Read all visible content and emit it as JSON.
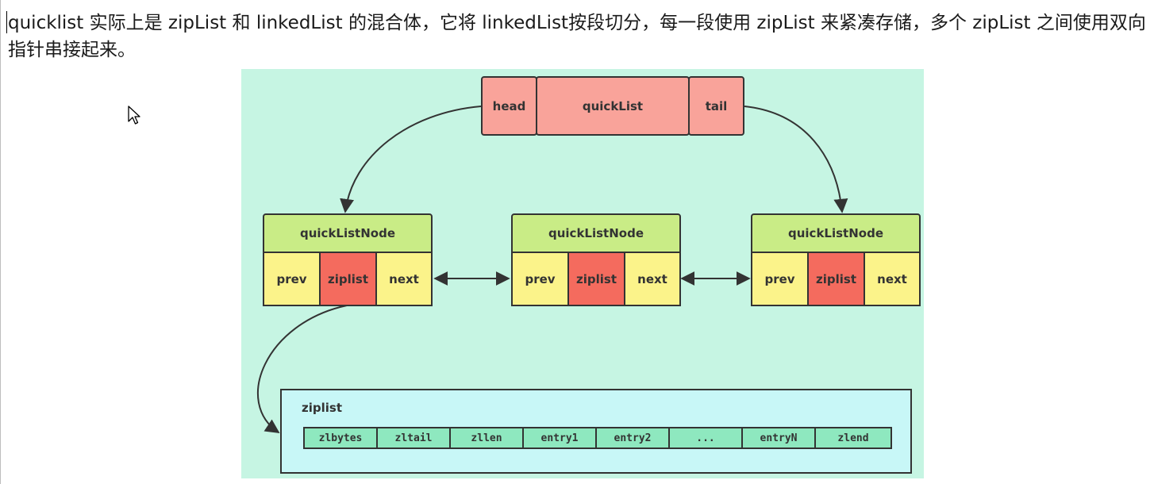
{
  "intro_text": "quicklist 实际上是 zipList 和 linkedList 的混合体，它将 linkedList按段切分，每一段使用 zipList 来紧凑存储，多个 zipList 之间使用双向指针串接起来。",
  "quicklist": {
    "head": "head",
    "title": "quickList",
    "tail": "tail"
  },
  "nodes": [
    {
      "title": "quickListNode",
      "prev": "prev",
      "ziplist": "ziplist",
      "next": "next"
    },
    {
      "title": "quickListNode",
      "prev": "prev",
      "ziplist": "ziplist",
      "next": "next"
    },
    {
      "title": "quickListNode",
      "prev": "prev",
      "ziplist": "ziplist",
      "next": "next"
    }
  ],
  "ziplist": {
    "title": "ziplist",
    "cells": [
      "zlbytes",
      "zltail",
      "zllen",
      "entry1",
      "entry2",
      "...",
      "entryN",
      "zlend"
    ]
  },
  "colors": {
    "background": "#c6f5e3",
    "quicklist": "#f9a39a",
    "node_title": "#c9ec86",
    "prev_next": "#fbf38a",
    "ziplist_cell": "#f46b5e",
    "ziplist_panel": "#c8f7f7",
    "ziplist_entry": "#8ee8bf"
  }
}
